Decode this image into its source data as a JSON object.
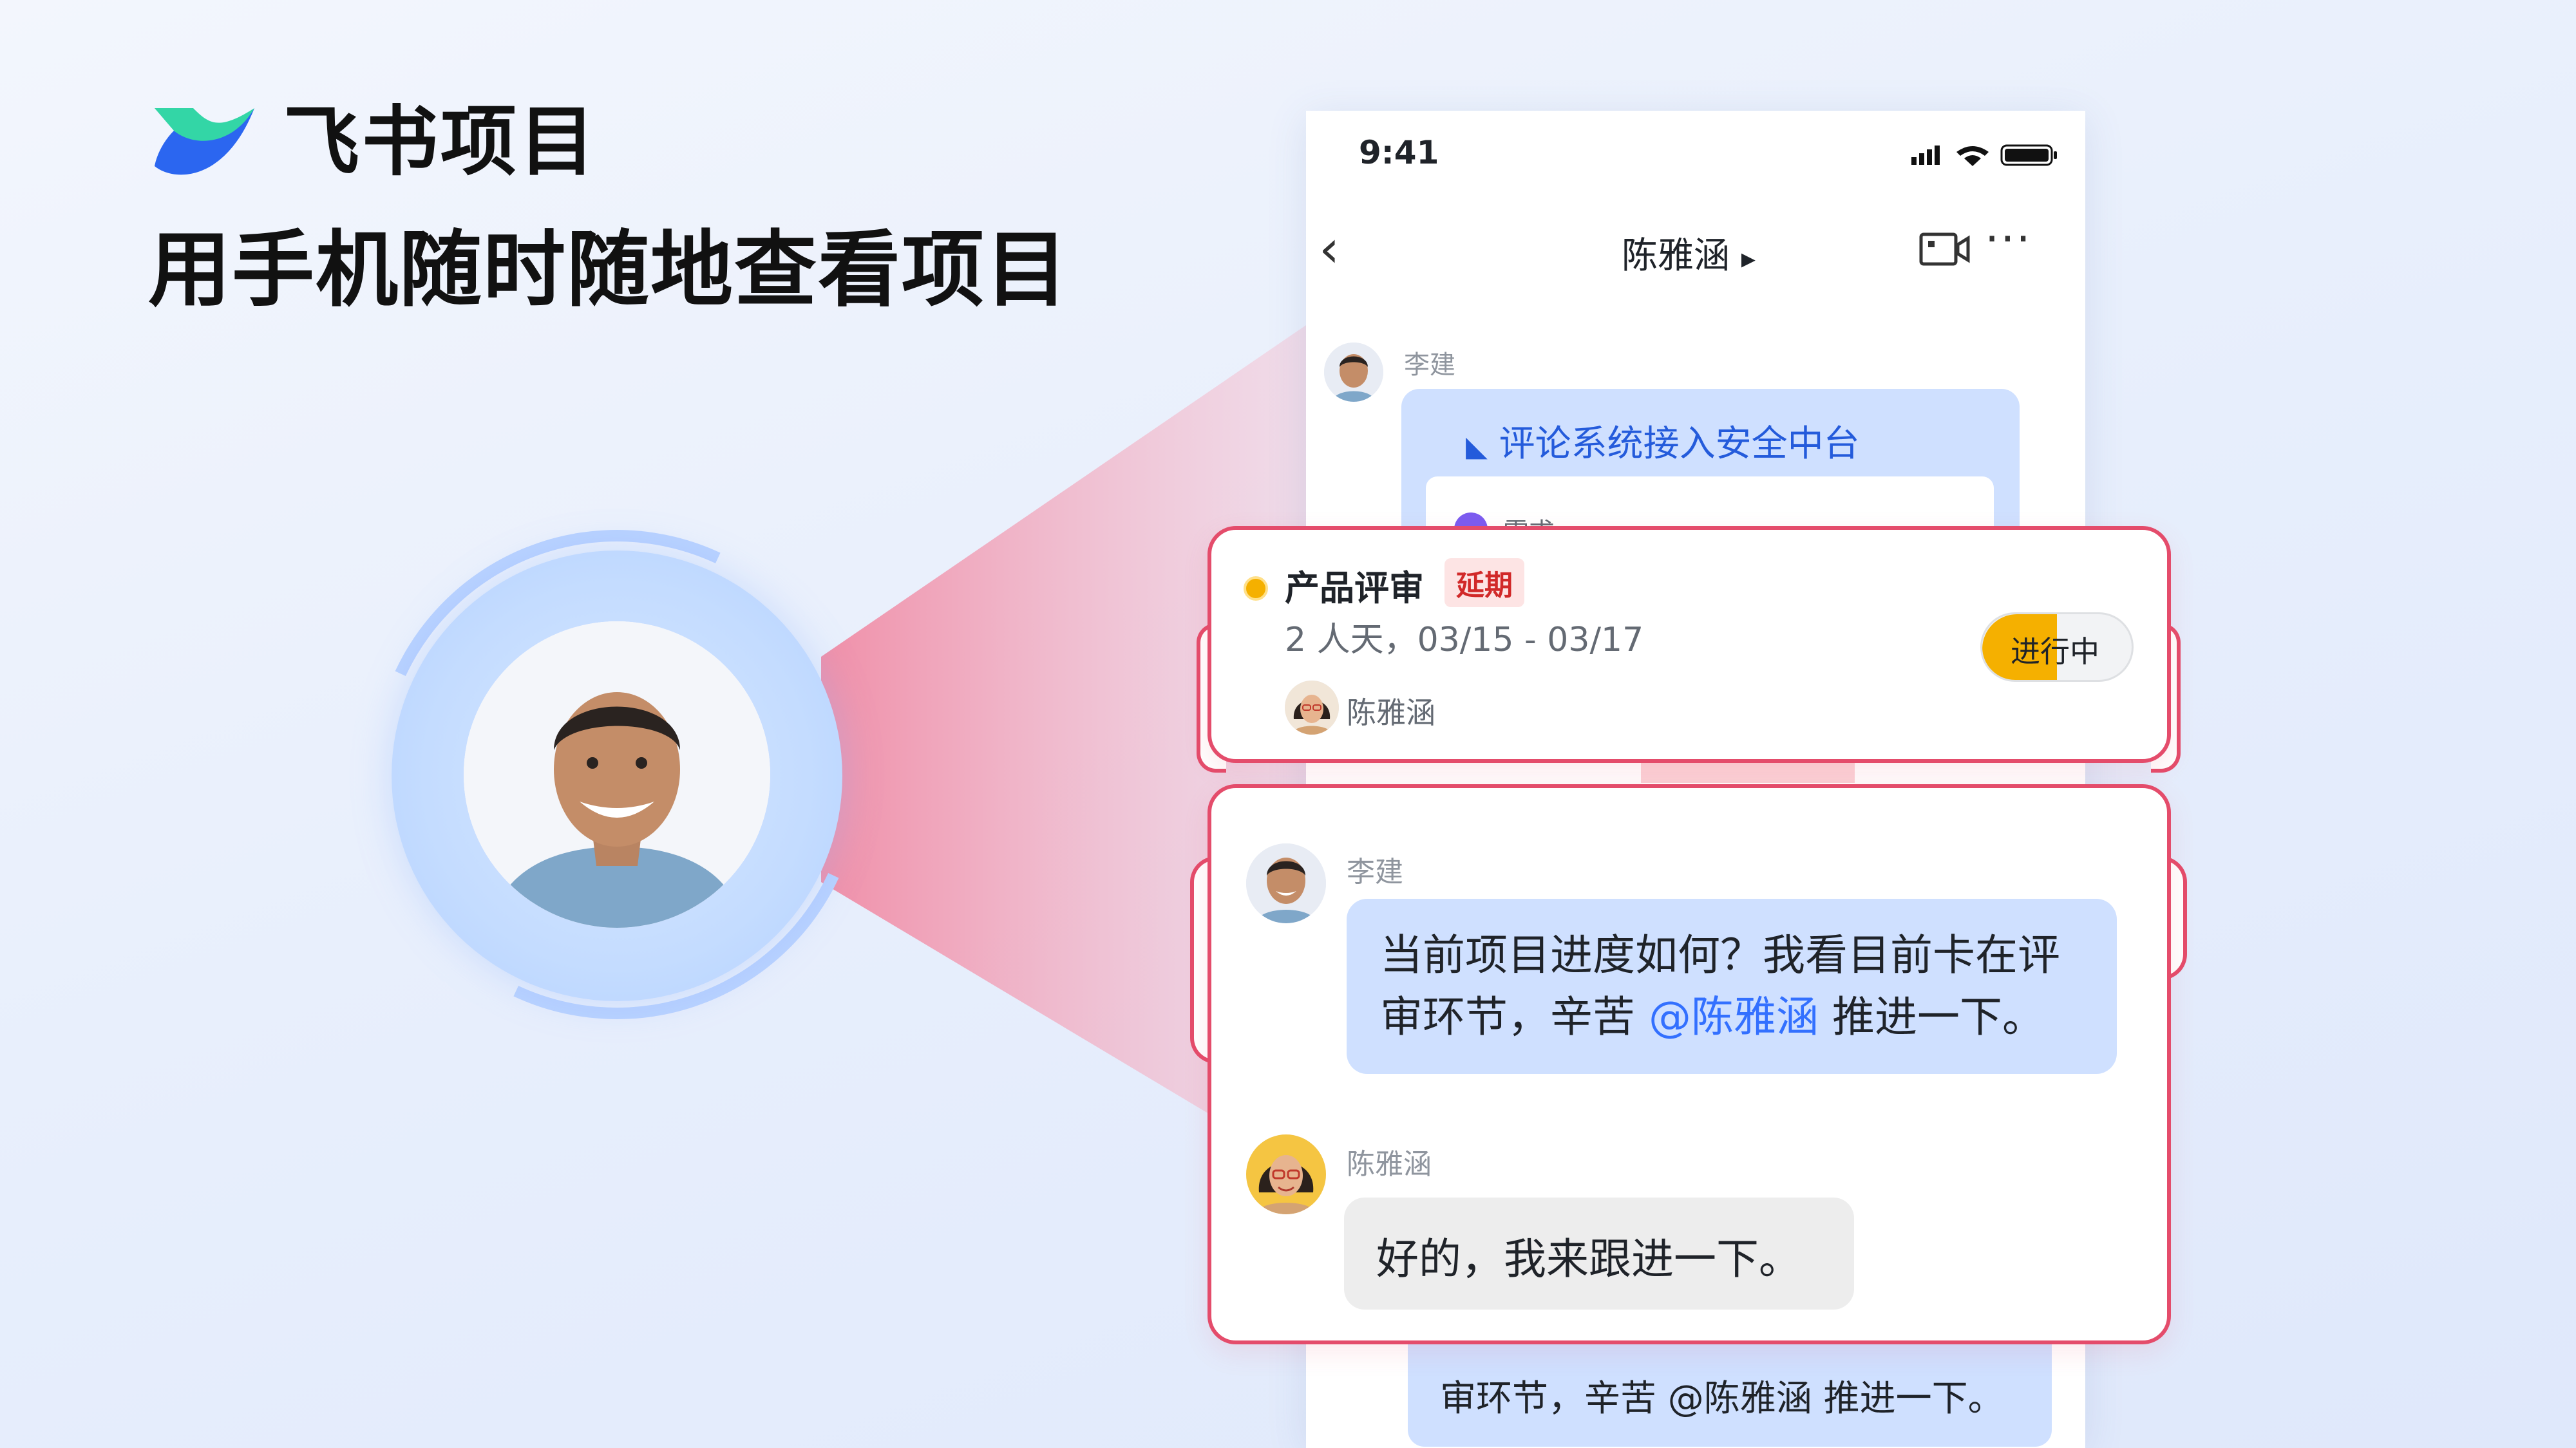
{
  "brand": {
    "name": "飞书项目",
    "headline": "用手机随时随地查看项目"
  },
  "colors": {
    "accent_red": "#e44c6b",
    "brand_blue": "#3370ff",
    "status_yellow": "#f5b000",
    "bubble_blue": "#cfe0ff"
  },
  "phone": {
    "status_time": "9:41",
    "nav_title": "陈雅涵",
    "nav_title_arrow": "▸",
    "back_icon": "‹",
    "more_icon": "···",
    "first_sender": "李建",
    "card_title": "评论系统接入安全中台",
    "card_sub_label": "需求",
    "bottom_bubble_text": "审环节，辛苦 @陈雅涵 推进一下。"
  },
  "task_card": {
    "name": "产品评审",
    "tag": "延期",
    "dates": "2 人天，03/15 - 03/17",
    "owner": "陈雅涵",
    "status": "进行中",
    "status_progress": 0.5
  },
  "chat_card": {
    "messages": [
      {
        "sender": "李建",
        "text_before": "当前项目进度如何？我看目前卡在评审环节，辛苦 ",
        "mention": "@陈雅涵",
        "text_after": " 推进一下。"
      },
      {
        "sender": "陈雅涵",
        "text": "好的，我来跟进一下。"
      }
    ]
  }
}
